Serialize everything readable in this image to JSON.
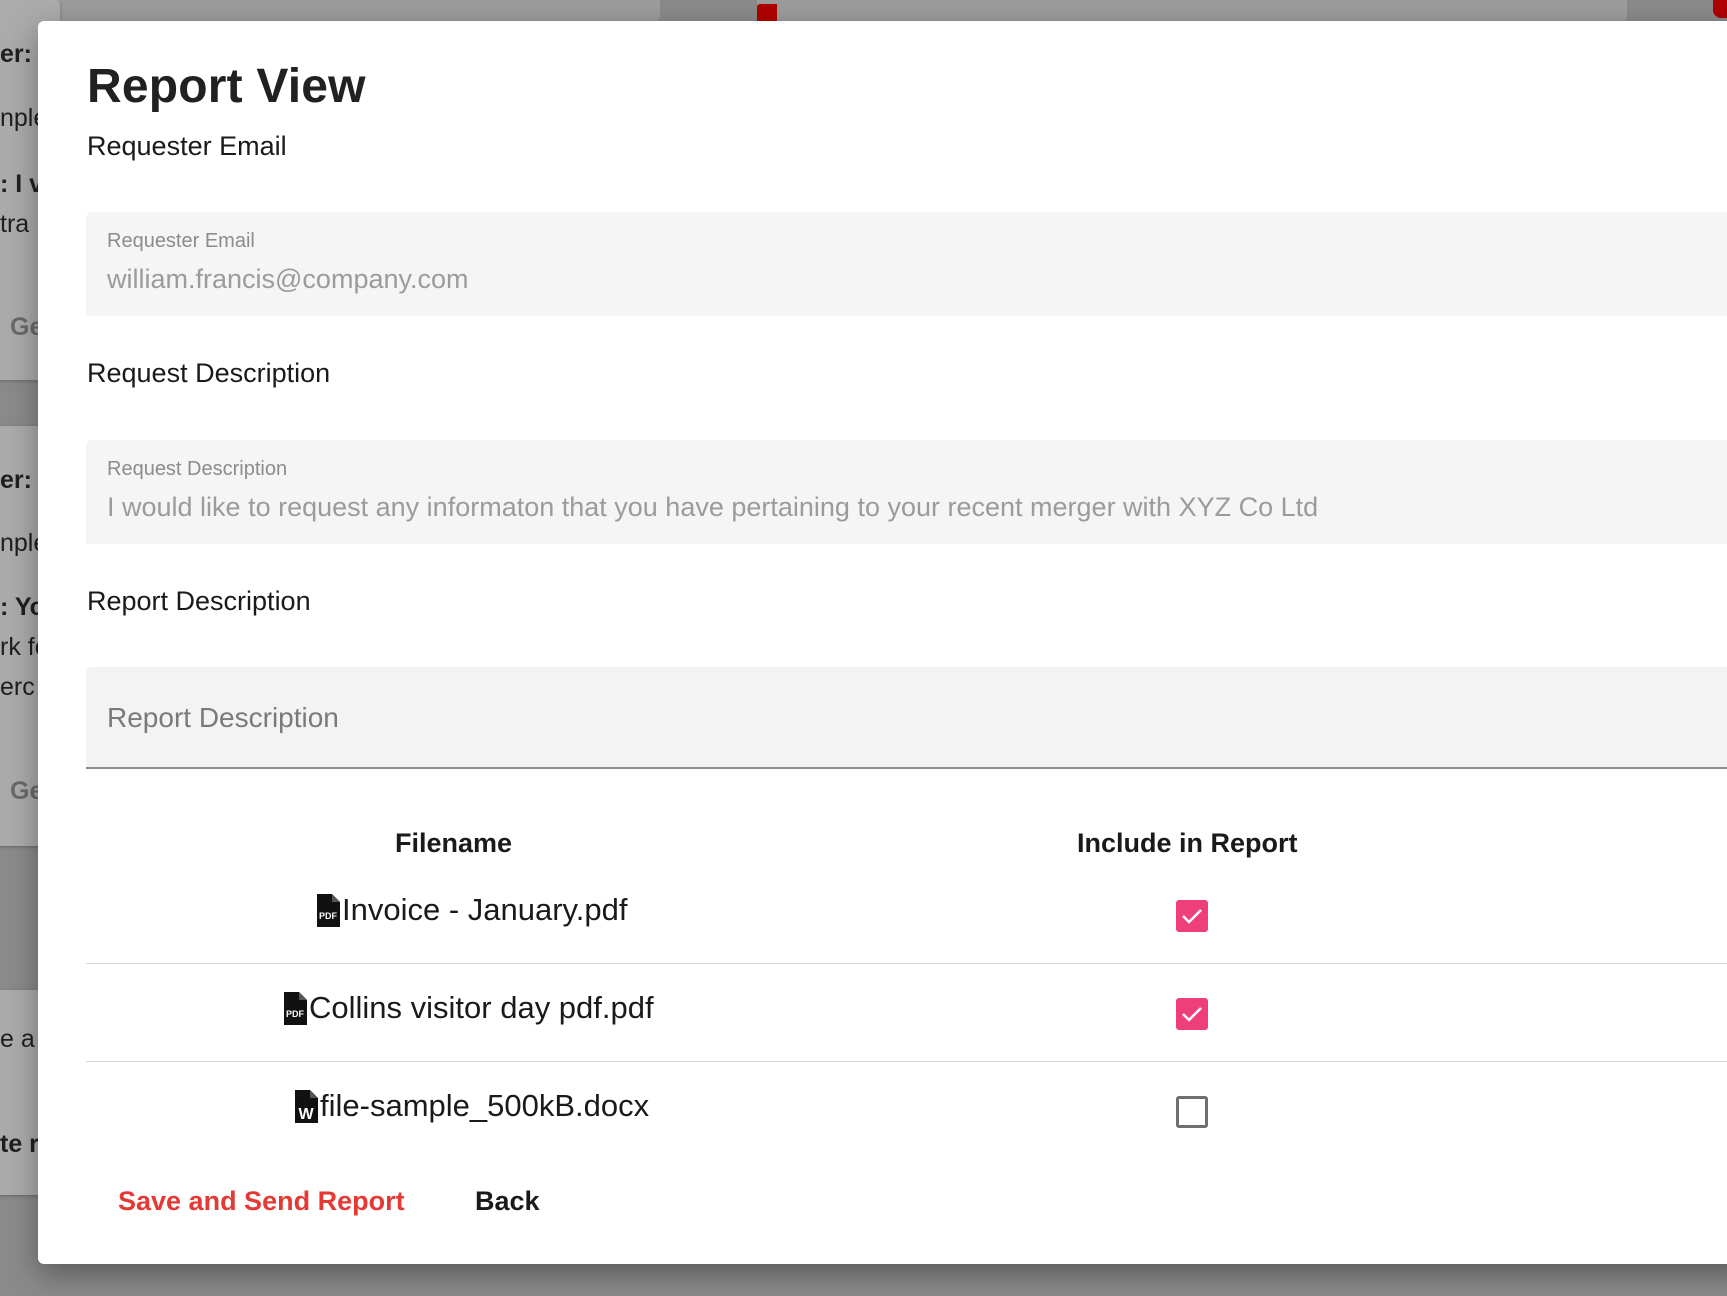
{
  "background": {
    "fragments": [
      {
        "text": "er:",
        "style": "bold"
      },
      {
        "text": "nple",
        "style": "normal"
      },
      {
        "text": ": I v",
        "style": "bold"
      },
      {
        "text": "tra",
        "style": "normal"
      },
      {
        "text": "Ge",
        "style": "muted"
      },
      {
        "text": "er:",
        "style": "bold"
      },
      {
        "text": "nple",
        "style": "normal"
      },
      {
        "text": ": Yo",
        "style": "bold"
      },
      {
        "text": "rk fo",
        "style": "normal"
      },
      {
        "text": "erc",
        "style": "normal"
      },
      {
        "text": "Ge",
        "style": "muted"
      },
      {
        "text": "e a",
        "style": "normal"
      },
      {
        "text": "te r",
        "style": "normal"
      }
    ]
  },
  "modal": {
    "title": "Report View",
    "requester_section_label": "Requester Email",
    "requester_field": {
      "label": "Requester Email",
      "value": "william.francis@company.com"
    },
    "request_section_label": "Request Description",
    "request_field": {
      "label": "Request Description",
      "value": "I would like to request any informaton that you have pertaining to your recent merger with XYZ Co Ltd"
    },
    "report_section_label": "Report Description",
    "report_field": {
      "placeholder": "Report Description",
      "value": ""
    },
    "table": {
      "headers": [
        "Filename",
        "Include in Report"
      ],
      "rows": [
        {
          "filename": "Invoice - January.pdf",
          "icon": "pdf-file-icon",
          "icon_text": "PDF",
          "included": true
        },
        {
          "filename": "Collins visitor day pdf.pdf",
          "icon": "pdf-file-icon",
          "icon_text": "PDF",
          "included": true
        },
        {
          "filename": "file-sample_500kB.docx",
          "icon": "word-file-icon",
          "icon_text": "W",
          "included": false
        }
      ]
    },
    "actions": {
      "save_label": "Save and Send Report",
      "back_label": "Back"
    }
  },
  "colors": {
    "accent_pink": "#ef3f7a",
    "action_red": "#e53935",
    "overlay": "#8a8a8a"
  }
}
